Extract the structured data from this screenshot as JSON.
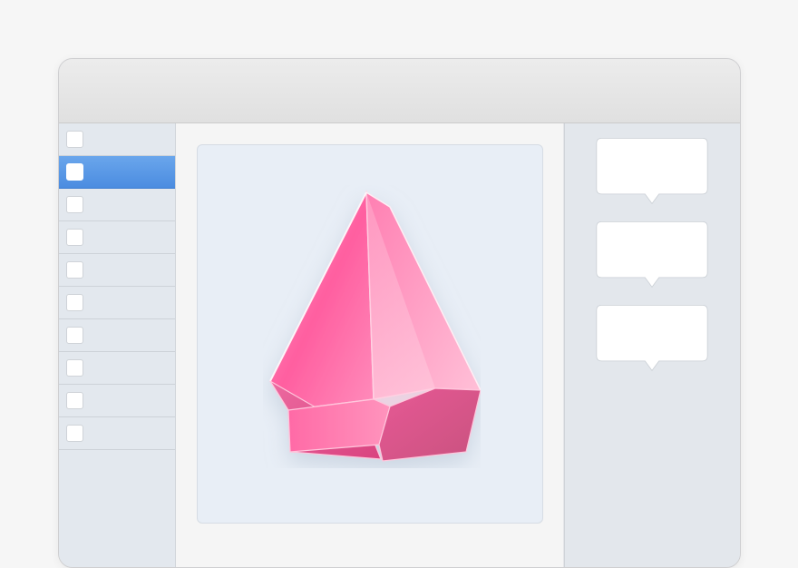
{
  "window": {
    "title": ""
  },
  "sidebar": {
    "items": [
      {
        "checked": false,
        "selected": false
      },
      {
        "checked": false,
        "selected": true
      },
      {
        "checked": false,
        "selected": false
      },
      {
        "checked": false,
        "selected": false
      },
      {
        "checked": false,
        "selected": false
      },
      {
        "checked": false,
        "selected": false
      },
      {
        "checked": false,
        "selected": false
      },
      {
        "checked": false,
        "selected": false
      },
      {
        "checked": false,
        "selected": false
      },
      {
        "checked": false,
        "selected": false
      }
    ]
  },
  "preview": {
    "icon": "pink-crystal-gem-icon"
  },
  "inspector": {
    "bubbles": [
      {
        "text": ""
      },
      {
        "text": ""
      },
      {
        "text": ""
      }
    ]
  },
  "colors": {
    "selection": "#4b8ce0",
    "gem_primary": "#f0508f",
    "gem_light": "#ffb0cf",
    "canvas_background": "#e8eef6"
  }
}
